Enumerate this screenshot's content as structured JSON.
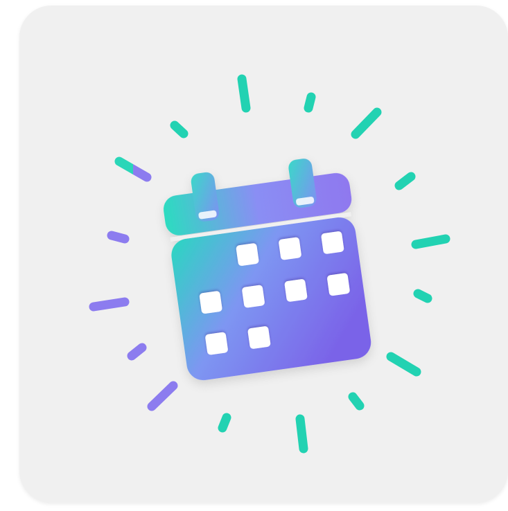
{
  "icon": {
    "name": "calendar-icon",
    "colors": {
      "tile": "#f0f0f0",
      "accent_teal": "#1fd8b4",
      "accent_purple": "#8f7bf0",
      "accent_blue": "#7d8ff5",
      "day_cell": "#ffffff"
    }
  }
}
